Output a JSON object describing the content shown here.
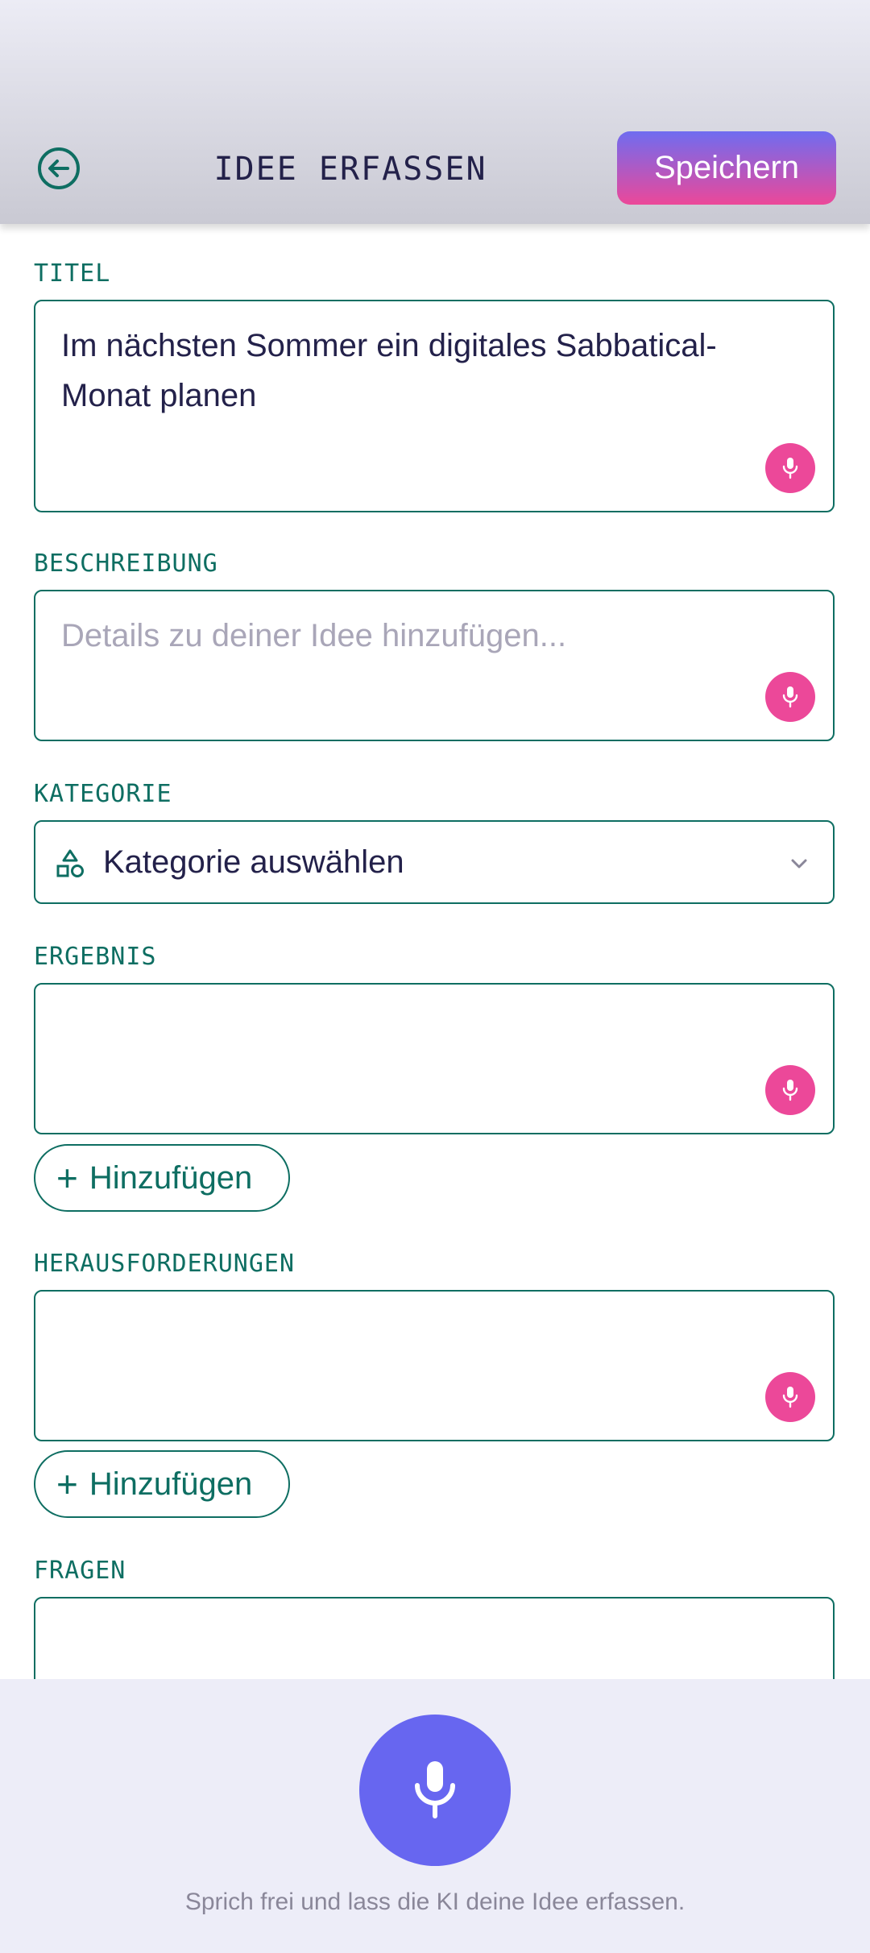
{
  "header": {
    "title": "IDEE ERFASSEN",
    "back_icon": "arrow-left-circle-icon",
    "save_label": "Speichern"
  },
  "form": {
    "title": {
      "label": "TITEL",
      "value": "Im nächsten Sommer ein digitales Sabbatical-Monat planen"
    },
    "description": {
      "label": "BESCHREIBUNG",
      "value": "",
      "placeholder": "Details zu deiner Idee hinzufügen..."
    },
    "category": {
      "label": "KATEGORIE",
      "selected": "Kategorie auswählen",
      "icon": "shapes-icon"
    },
    "result": {
      "label": "ERGEBNIS",
      "value": "",
      "add_label": "Hinzufügen"
    },
    "challenges": {
      "label": "HERAUSFORDERUNGEN",
      "value": "",
      "add_label": "Hinzufügen"
    },
    "questions": {
      "label": "FRAGEN",
      "value": ""
    }
  },
  "footer": {
    "hint": "Sprich frei und lass die KI deine Idee erfassen.",
    "mic_icon": "microphone-icon"
  },
  "colors": {
    "accent": "#0e6e62",
    "mic_pink": "#ec4899",
    "primary": "#6766f0",
    "text": "#23214a"
  }
}
